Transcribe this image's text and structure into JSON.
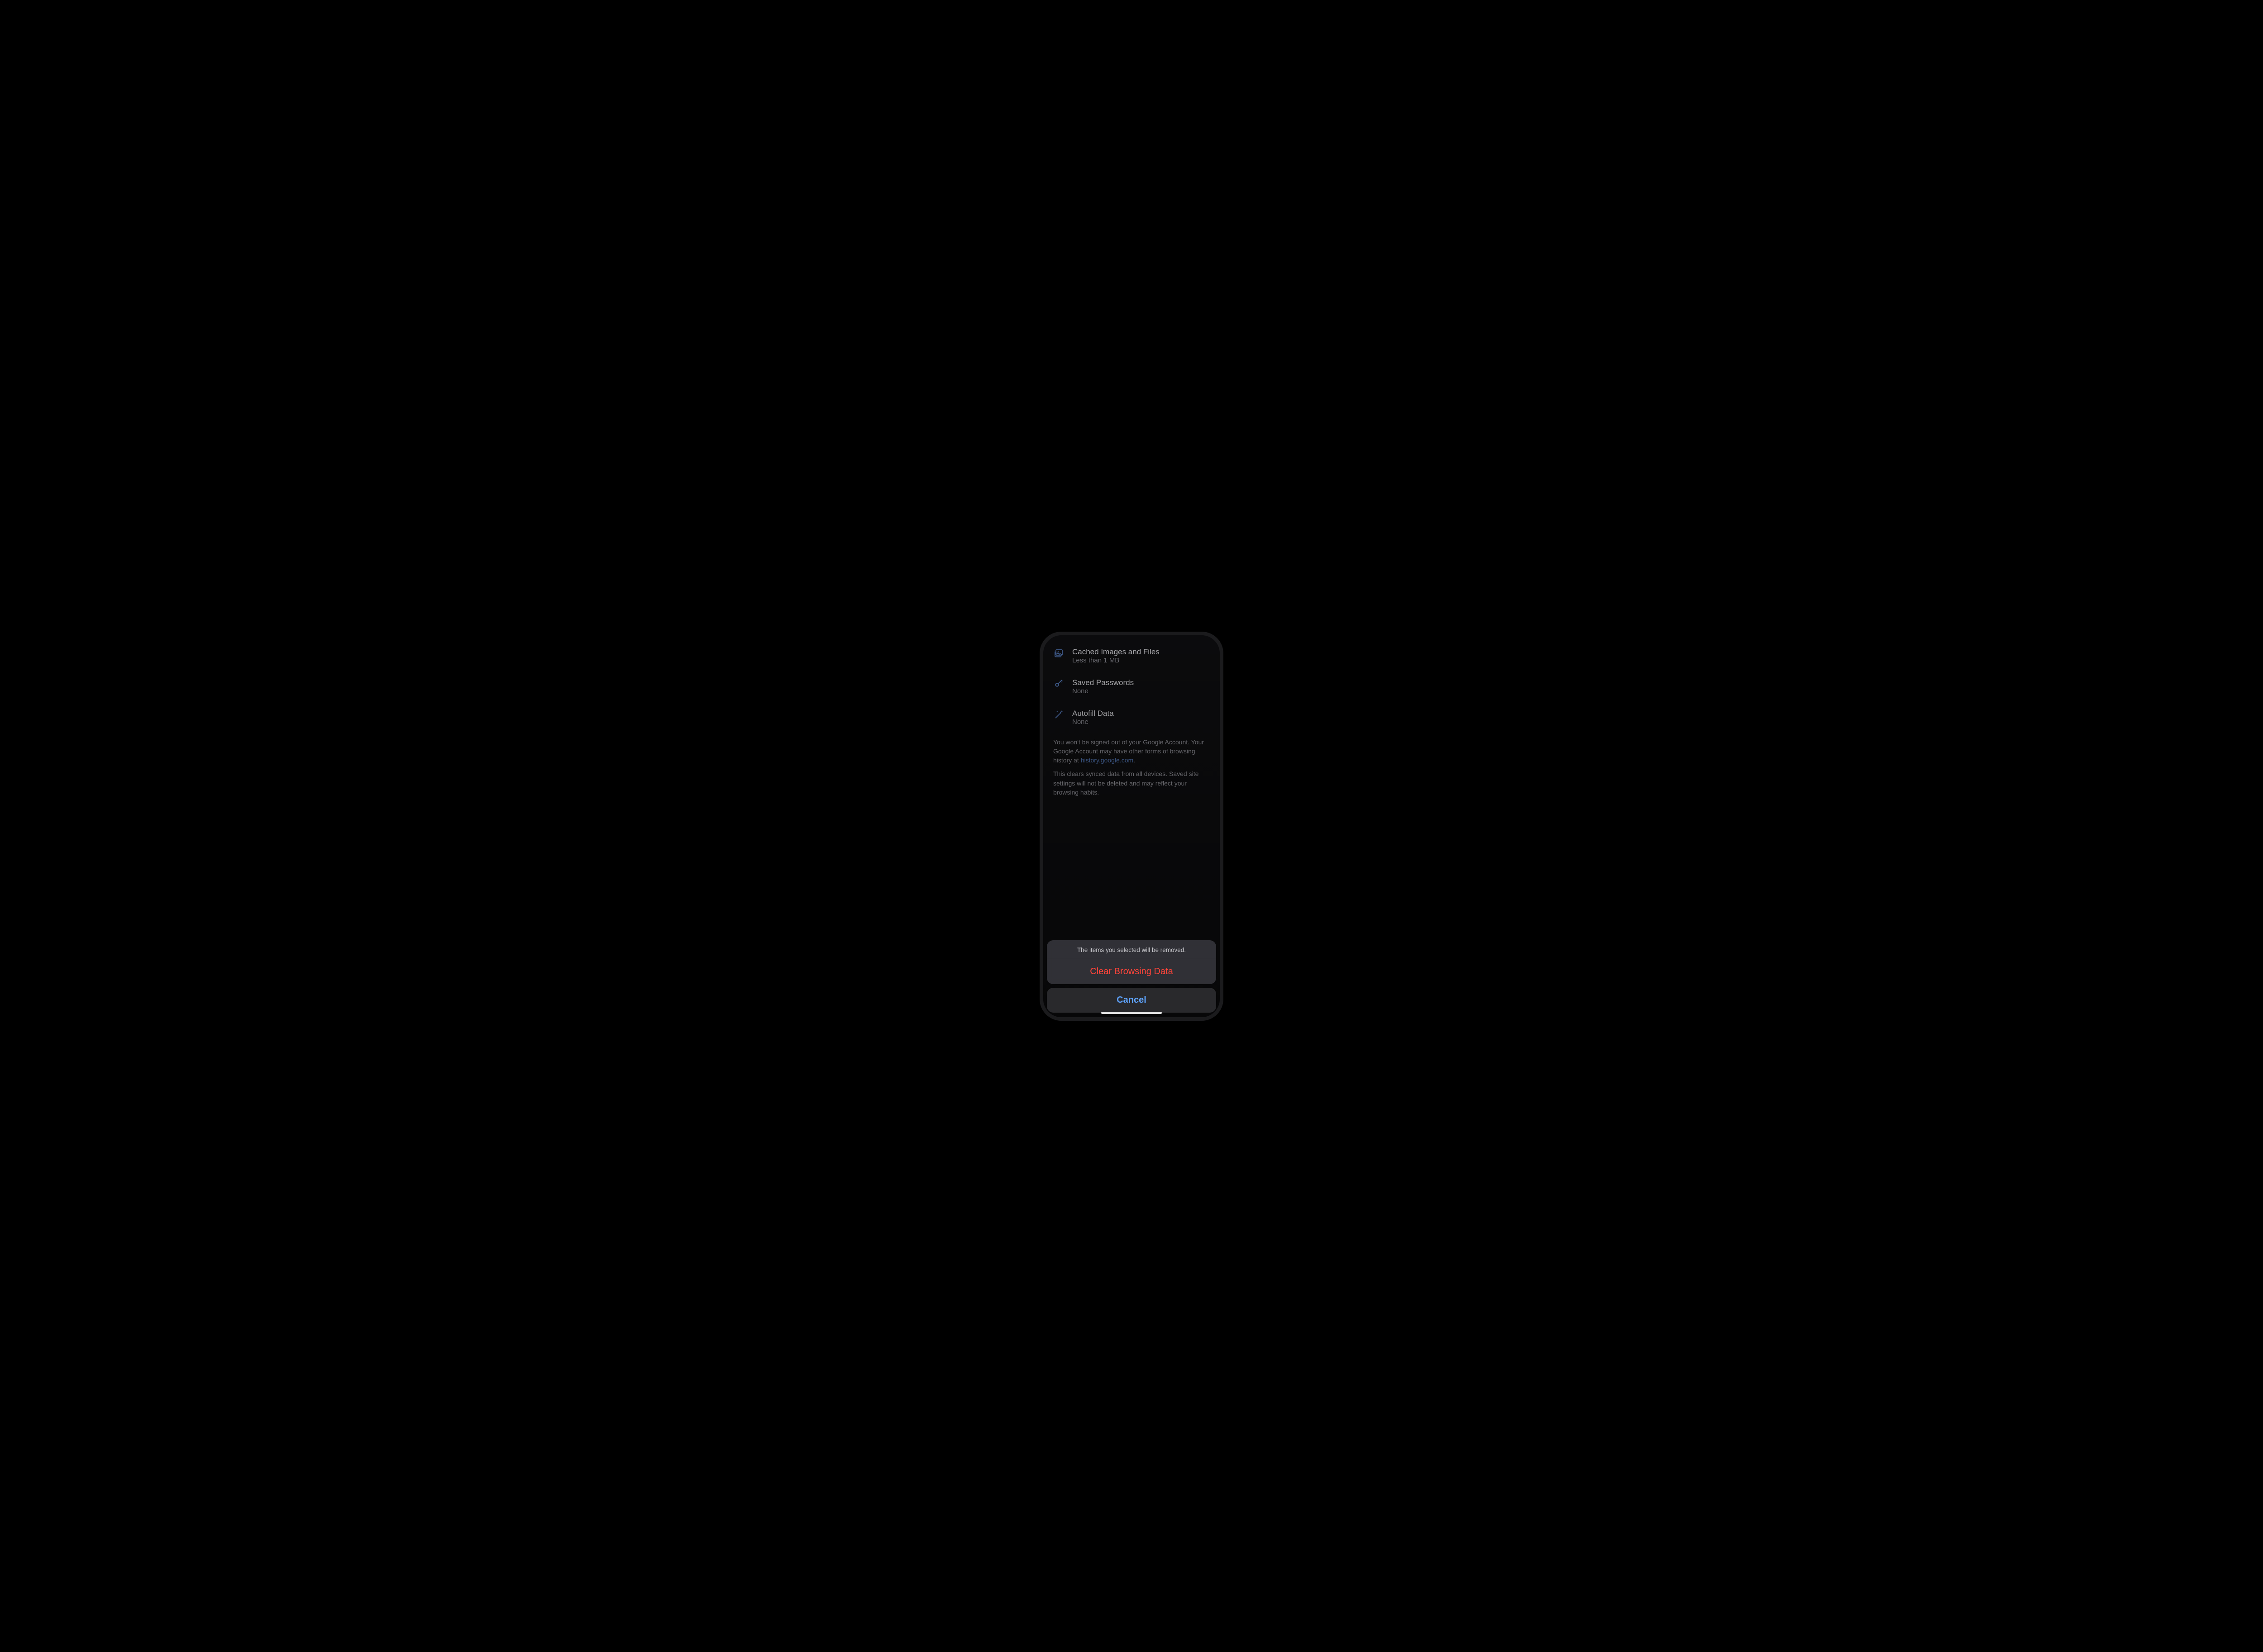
{
  "settings_rows": {
    "cached": {
      "title": "Cached Images and Files",
      "subtitle": "Less than 1 MB"
    },
    "passwords": {
      "title": "Saved Passwords",
      "subtitle": "None"
    },
    "autofill": {
      "title": "Autofill Data",
      "subtitle": "None"
    }
  },
  "info": {
    "signed_out_note_pre": "You won't be signed out of your Google Account. Your Google Account may have other forms of browsing history at ",
    "history_link_text": "history.google.com",
    "signed_out_note_post": ".",
    "sync_note": "This clears synced data from all devices. Saved site settings will not be deleted and may reflect your browsing habits."
  },
  "action_sheet": {
    "message": "The items you selected will be removed.",
    "clear_label": "Clear Browsing Data",
    "cancel_label": "Cancel"
  },
  "colors": {
    "destructive": "#ff453a",
    "accent_blue": "#5fa4ff",
    "link_blue": "#5b83c8"
  }
}
